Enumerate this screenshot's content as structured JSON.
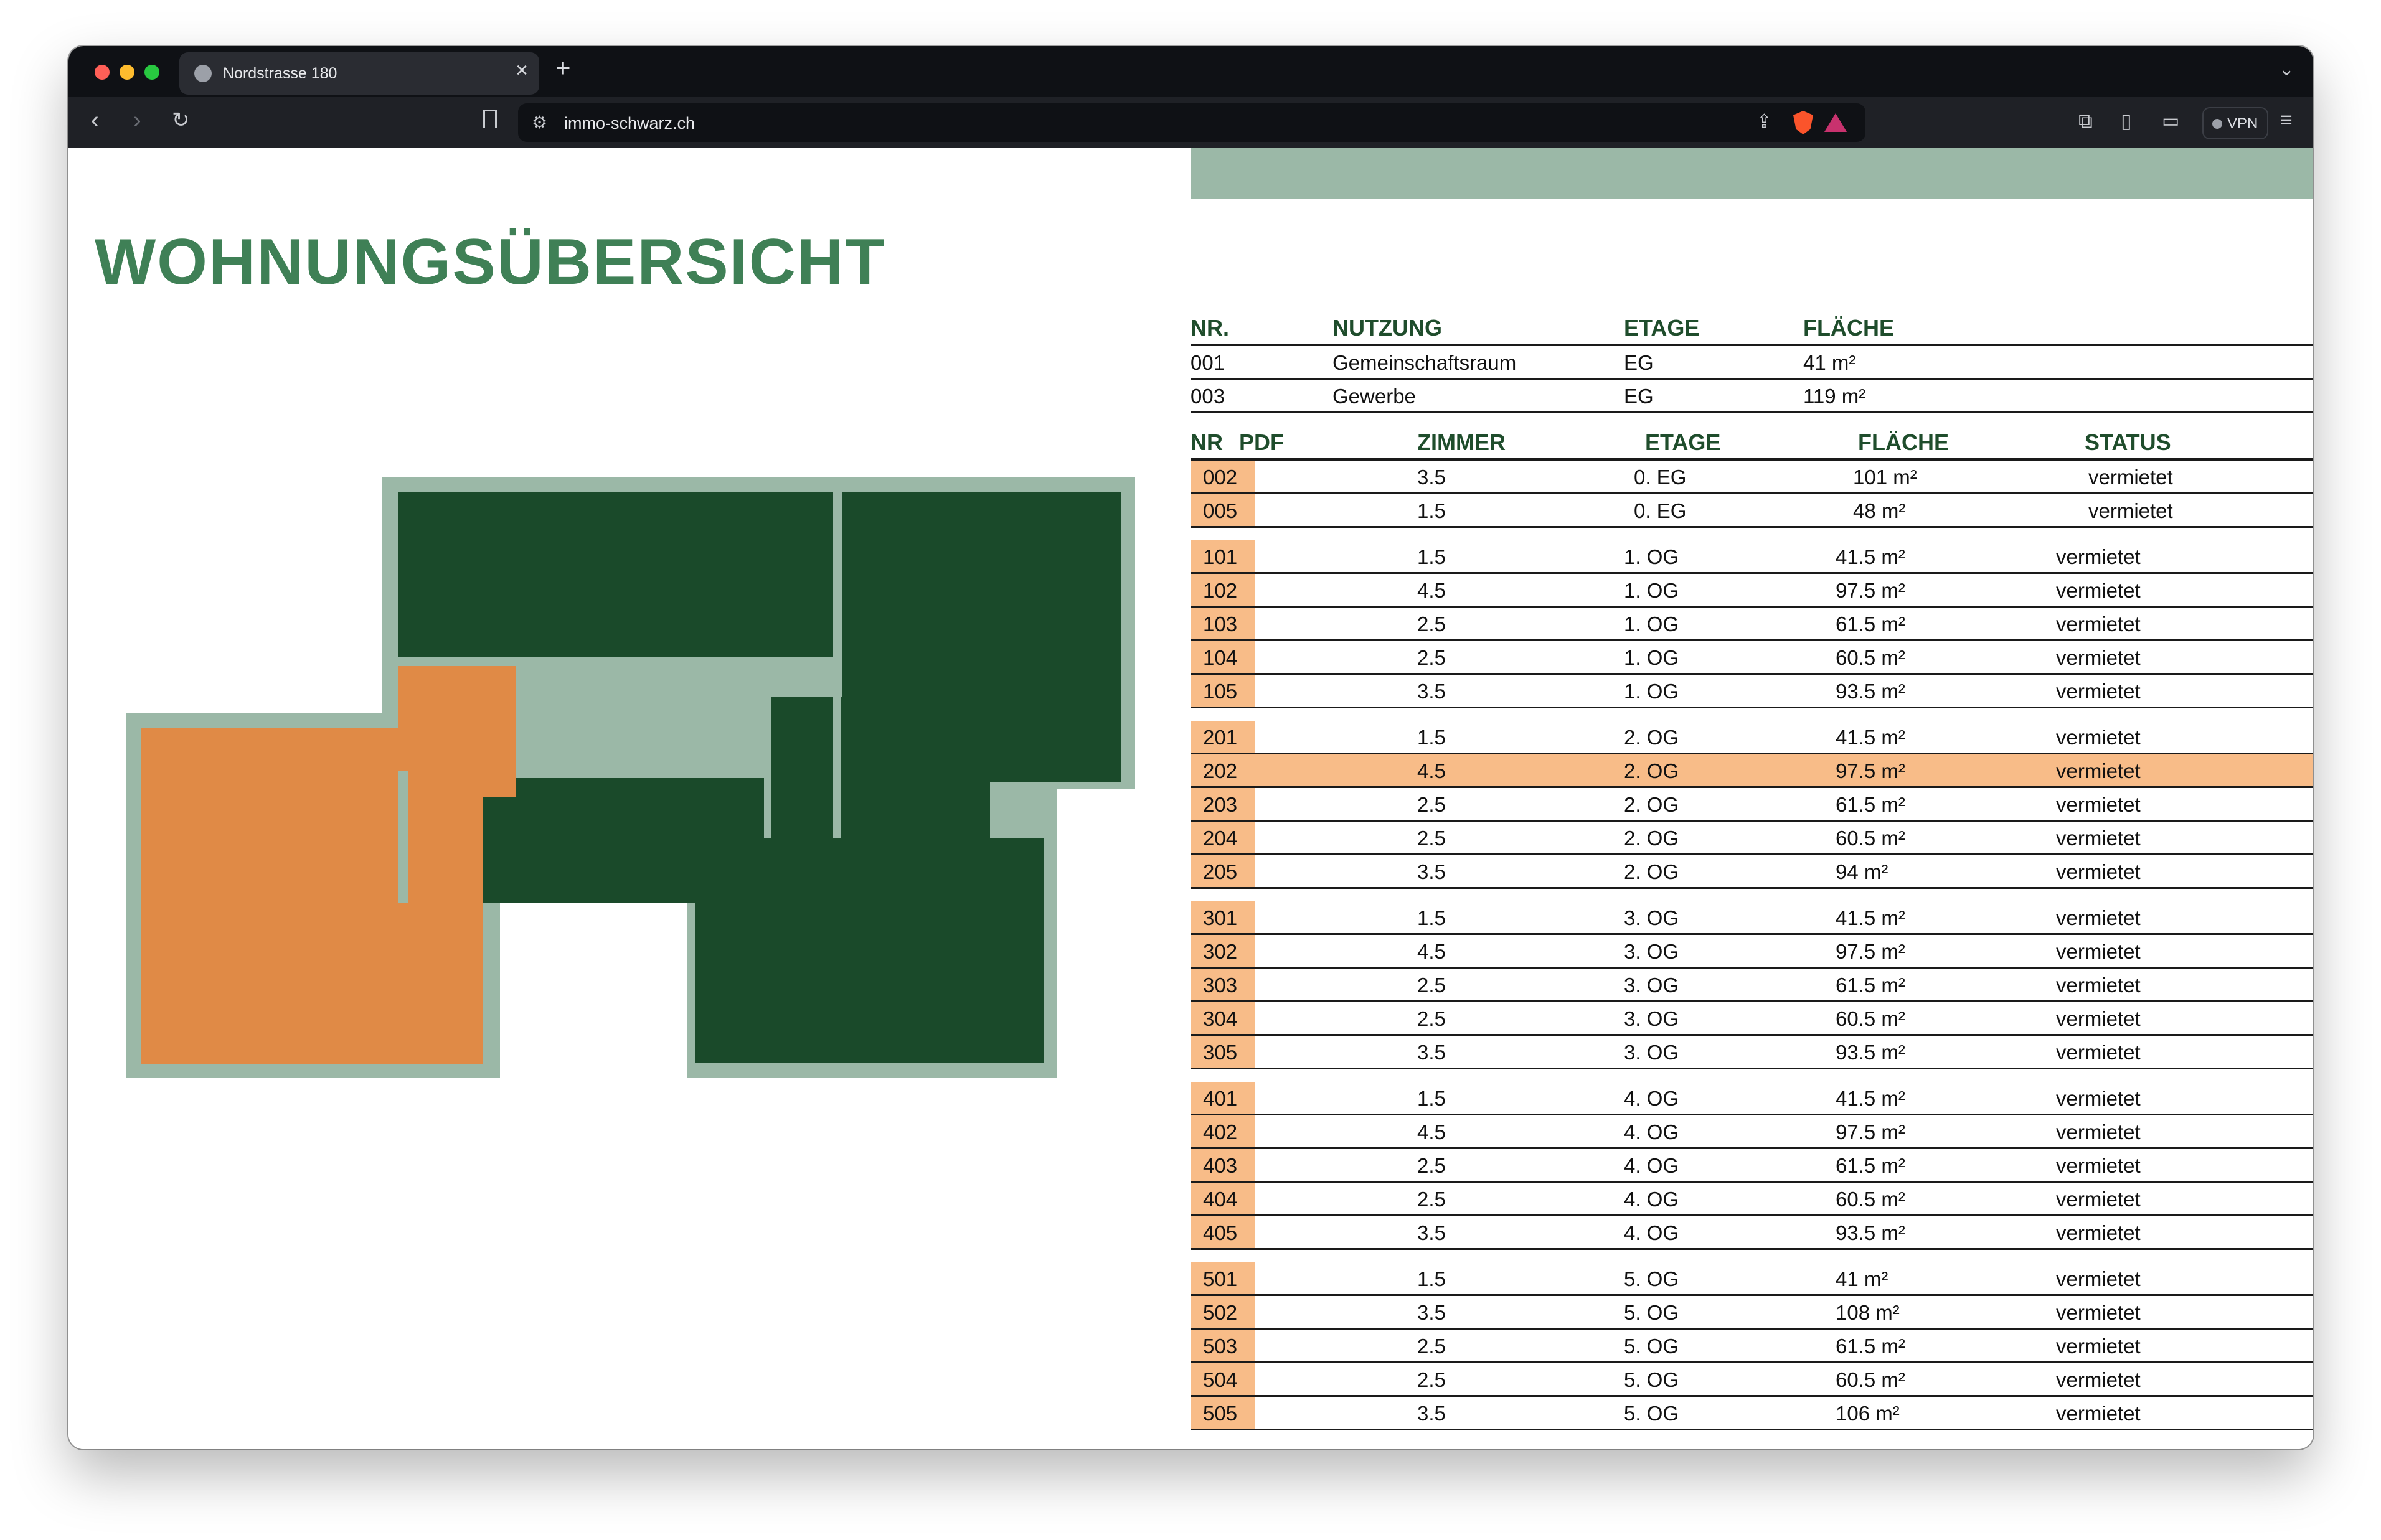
{
  "browser": {
    "tab_title": "Nordstrasse 180",
    "url": "immo-schwarz.ch",
    "vpn_label": "VPN",
    "new_tab": "+",
    "close": "×"
  },
  "page": {
    "title": "WOHNUNGSÜBERSICHT"
  },
  "colors": {
    "dark_green": "#1a4a2a",
    "sage": "#9bb8a7",
    "orange": "#e08a46",
    "highlight": "#f8bc88",
    "title_green": "#3f8056"
  },
  "commercial_table": {
    "headers": [
      "NR.",
      "NUTZUNG",
      "ETAGE",
      "FLÄCHE"
    ],
    "rows": [
      [
        "001",
        "Gemeinschaftsraum",
        "EG",
        "41 m²"
      ],
      [
        "003",
        "Gewerbe",
        "EG",
        "119 m²"
      ]
    ]
  },
  "apartment_table": {
    "headers": [
      "NR",
      "PDF",
      "ZIMMER",
      "ETAGE",
      "FLÄCHE",
      "STATUS"
    ],
    "ground": [
      [
        "002",
        "3.5",
        "0. EG",
        "101 m²",
        "vermietet"
      ],
      [
        "005",
        "1.5",
        "0. EG",
        "48 m²",
        "vermietet"
      ]
    ],
    "groups": [
      [
        [
          "101",
          "1.5",
          "1. OG",
          "41.5 m²",
          "vermietet"
        ],
        [
          "102",
          "4.5",
          "1. OG",
          "97.5 m²",
          "vermietet"
        ],
        [
          "103",
          "2.5",
          "1. OG",
          "61.5 m²",
          "vermietet"
        ],
        [
          "104",
          "2.5",
          "1. OG",
          "60.5 m²",
          "vermietet"
        ],
        [
          "105",
          "3.5",
          "1. OG",
          "93.5 m²",
          "vermietet"
        ]
      ],
      [
        [
          "201",
          "1.5",
          "2. OG",
          "41.5 m²",
          "vermietet"
        ],
        [
          "202",
          "4.5",
          "2. OG",
          "97.5 m²",
          "vermietet"
        ],
        [
          "203",
          "2.5",
          "2. OG",
          "61.5 m²",
          "vermietet"
        ],
        [
          "204",
          "2.5",
          "2. OG",
          "60.5 m²",
          "vermietet"
        ],
        [
          "205",
          "3.5",
          "2. OG",
          "94 m²",
          "vermietet"
        ]
      ],
      [
        [
          "301",
          "1.5",
          "3. OG",
          "41.5 m²",
          "vermietet"
        ],
        [
          "302",
          "4.5",
          "3. OG",
          "97.5 m²",
          "vermietet"
        ],
        [
          "303",
          "2.5",
          "3. OG",
          "61.5 m²",
          "vermietet"
        ],
        [
          "304",
          "2.5",
          "3. OG",
          "60.5 m²",
          "vermietet"
        ],
        [
          "305",
          "3.5",
          "3. OG",
          "93.5 m²",
          "vermietet"
        ]
      ],
      [
        [
          "401",
          "1.5",
          "4. OG",
          "41.5 m²",
          "vermietet"
        ],
        [
          "402",
          "4.5",
          "4. OG",
          "97.5 m²",
          "vermietet"
        ],
        [
          "403",
          "2.5",
          "4. OG",
          "61.5 m²",
          "vermietet"
        ],
        [
          "404",
          "2.5",
          "4. OG",
          "60.5 m²",
          "vermietet"
        ],
        [
          "405",
          "3.5",
          "4. OG",
          "93.5 m²",
          "vermietet"
        ]
      ],
      [
        [
          "501",
          "1.5",
          "5. OG",
          "41 m²",
          "vermietet"
        ],
        [
          "502",
          "3.5",
          "5. OG",
          "108 m²",
          "vermietet"
        ],
        [
          "503",
          "2.5",
          "5. OG",
          "61.5 m²",
          "vermietet"
        ],
        [
          "504",
          "2.5",
          "5. OG",
          "60.5 m²",
          "vermietet"
        ],
        [
          "505",
          "3.5",
          "5. OG",
          "106 m²",
          "vermietet"
        ]
      ]
    ],
    "highlighted_nr": "202"
  }
}
